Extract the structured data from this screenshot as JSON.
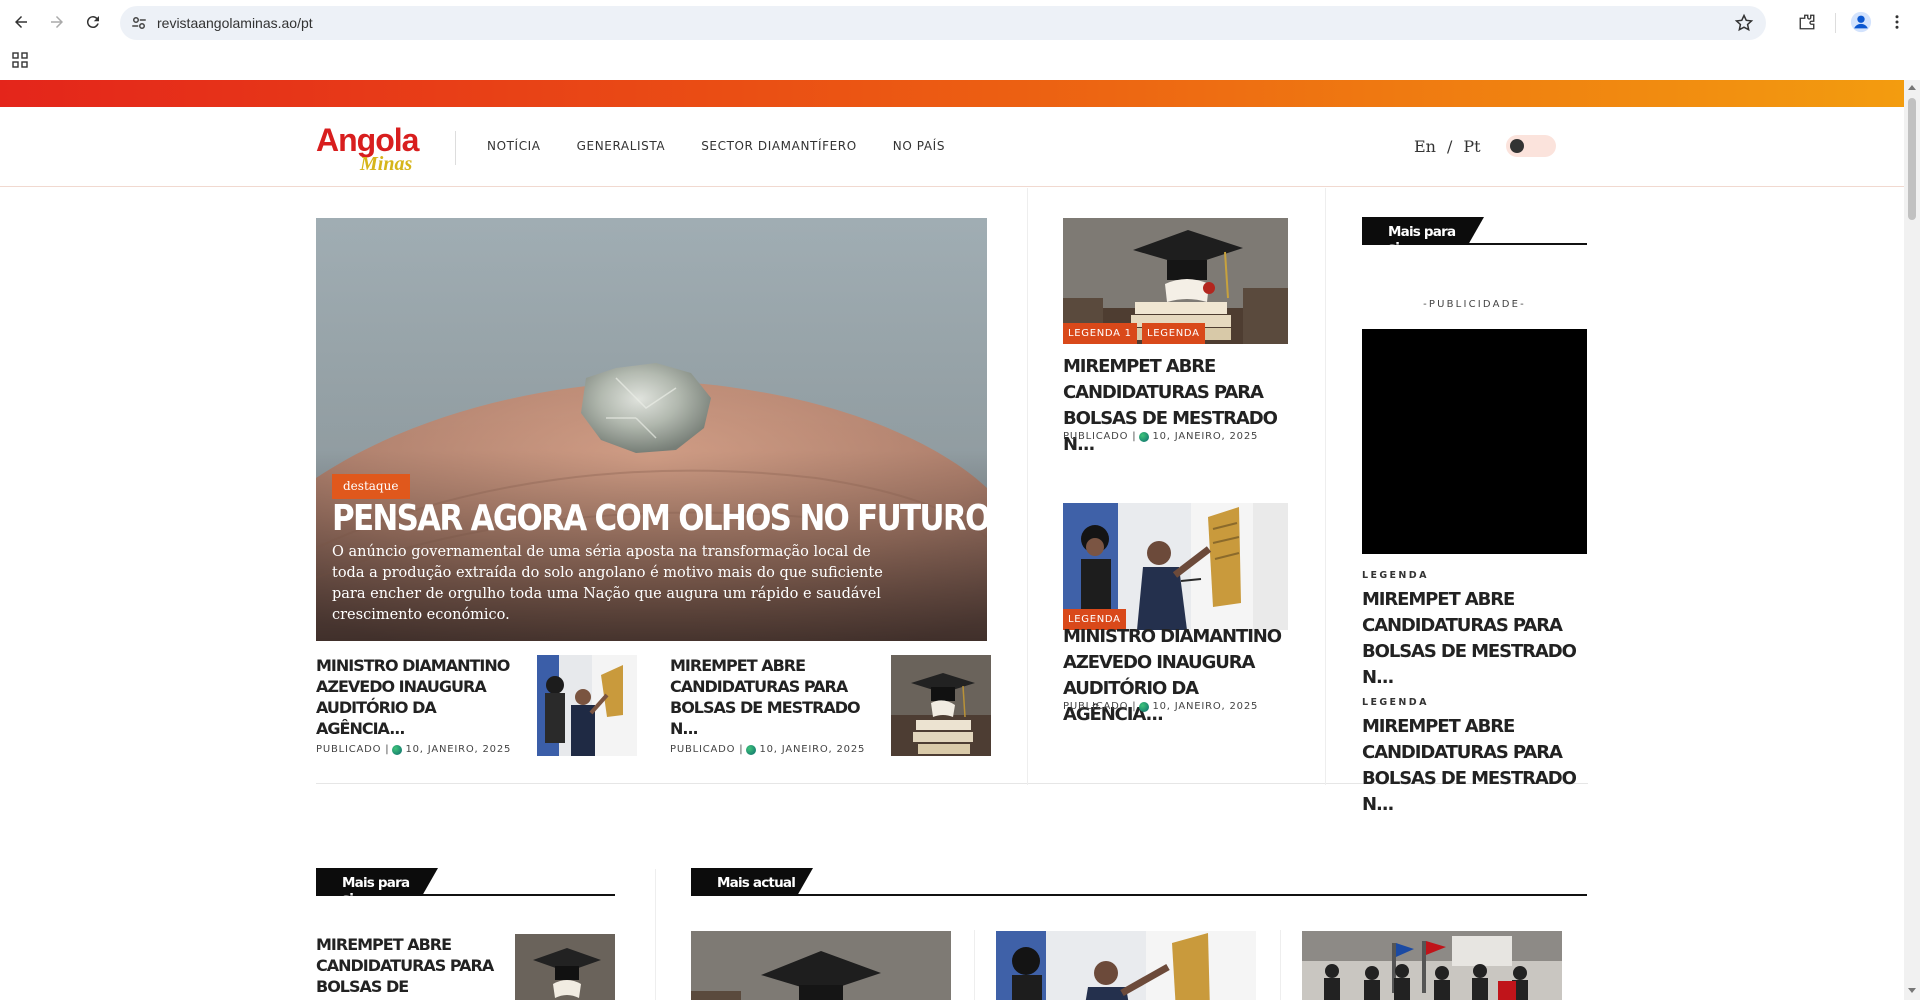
{
  "browser": {
    "url": "revistaangolaminas.ao/pt"
  },
  "site": {
    "logo_main": "Angola",
    "logo_sub": "Minas",
    "nav": [
      "NOTÍCIA",
      "GENERALISTA",
      "SECTOR DIAMANTÍFERO",
      "NO PAÍS"
    ],
    "lang_en": "En",
    "lang_sep": "/",
    "lang_pt": "Pt",
    "theme_toggle": "off"
  },
  "hero": {
    "badge": "destaque",
    "title": "Pensar agora com olhos no futuro",
    "text": "O anúncio governamental de uma séria aposta na transformação local de toda a produção extraída do solo angolano é motivo mais do que suficiente para  encher de orgulho toda uma Nação que augura um rápido e saudável crescimento económico."
  },
  "mini_articles": [
    {
      "title": "MINISTRO DIAMANTINO AZEVEDO INAUGURA AUDITÓRIO DA AGÊNCIA...",
      "meta_prefix": "PUBLICADO |",
      "date": "10, JANEIRO, 2025"
    },
    {
      "title": "MIREMPET ABRE CANDIDATURAS PARA BOLSAS DE MESTRADO N...",
      "meta_prefix": "PUBLICADO |",
      "date": "10, JANEIRO, 2025"
    }
  ],
  "mid_articles": [
    {
      "tags": [
        "LEGENDA 1",
        "LEGENDA"
      ],
      "title": "MIREMPET ABRE CANDIDATURAS PARA BOLSAS DE MESTRADO N...",
      "meta_prefix": "PUBLICADO |",
      "date": "10, JANEIRO, 2025"
    },
    {
      "tags": [
        "LEGENDA"
      ],
      "title": "MINISTRO DIAMANTINO AZEVEDO INAUGURA AUDITÓRIO DA AGÊNCIA...",
      "meta_prefix": "PUBLICADO |",
      "date": "10, JANEIRO, 2025"
    }
  ],
  "sidebar": {
    "heading": "Mais para si",
    "ad_label": "-PUBLICIDADE-",
    "items": [
      {
        "legend": "LEGENDA",
        "title": "MIREMPET ABRE CANDIDATURAS PARA BOLSAS DE MESTRADO N..."
      },
      {
        "legend": "LEGENDA",
        "title": "MIREMPET ABRE CANDIDATURAS PARA BOLSAS DE MESTRADO N..."
      }
    ]
  },
  "bottom": {
    "left_heading": "Mais para si",
    "right_heading": "Mais actual",
    "left_item_title": "MIREMPET ABRE CANDIDATURAS PARA BOLSAS DE MESTRAD..."
  },
  "colors": {
    "accent": "#e0581c",
    "brand_red": "#d81e1e",
    "brand_gold": "#d6b51a"
  }
}
